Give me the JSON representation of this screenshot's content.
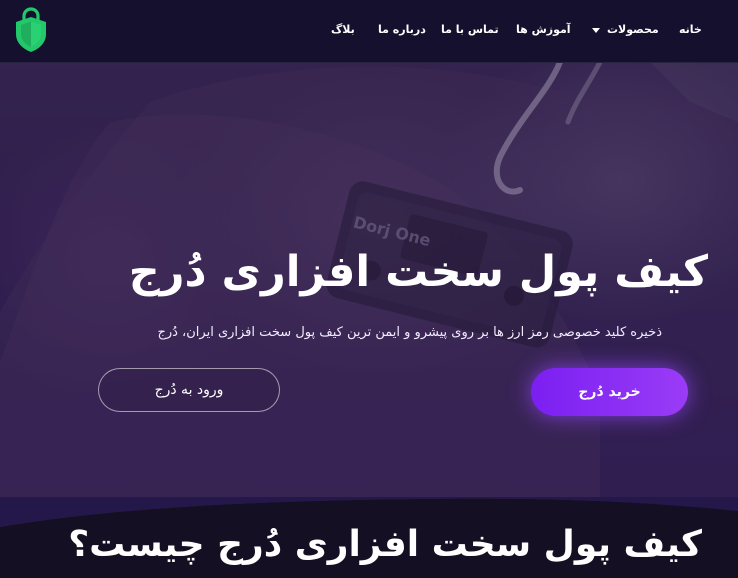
{
  "nav": {
    "logo_icon": "shield-lock-icon",
    "items": [
      {
        "label": "خانه"
      },
      {
        "label": "محصولات",
        "icon": "chevron-down-icon"
      },
      {
        "label": "آموزش ها"
      },
      {
        "label": "تماس با ما"
      },
      {
        "label": "درباره ما"
      },
      {
        "label": "بلاگ"
      }
    ]
  },
  "hero": {
    "title": "کیف پول سخت افزاری دُرج",
    "subtitle": "ذخیره کلید خصوصی رمز ارز ها بر روی پیشرو و ایمن ترین کیف پول سخت افزاری ایران، دُرج",
    "device_label": "Dorj One",
    "primary_button": "خرید دُرج",
    "secondary_button": "ورود به دُرج"
  },
  "section": {
    "title": "کیف پول سخت افزاری دُرج چیست؟"
  },
  "colors": {
    "navbar_bg": "#15102e",
    "accent_purple": "#8a2ef5",
    "logo_green": "#22c96b"
  }
}
